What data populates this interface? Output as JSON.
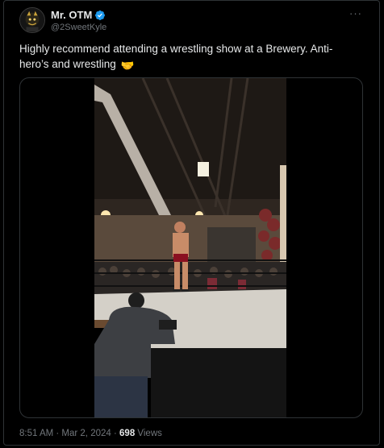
{
  "author": {
    "display_name": "Mr. OTM",
    "handle": "@2SweetKyle",
    "verified": true
  },
  "tweet": {
    "text": "Highly recommend attending a wrestling show at a Brewery. Anti-hero’s and wrestling",
    "emoji": "🤝"
  },
  "meta": {
    "timestamp": "8:51 AM · Mar 2, 2024",
    "separator": " · ",
    "views_count": "698",
    "views_label": " Views"
  },
  "colors": {
    "background": "#000000",
    "text_primary": "#e7e9ea",
    "text_secondary": "#71767b",
    "border": "#2f3336",
    "verified": "#1d9bf0"
  },
  "icons": {
    "more": "more-horizontal-icon",
    "verified": "verified-badge-icon"
  }
}
